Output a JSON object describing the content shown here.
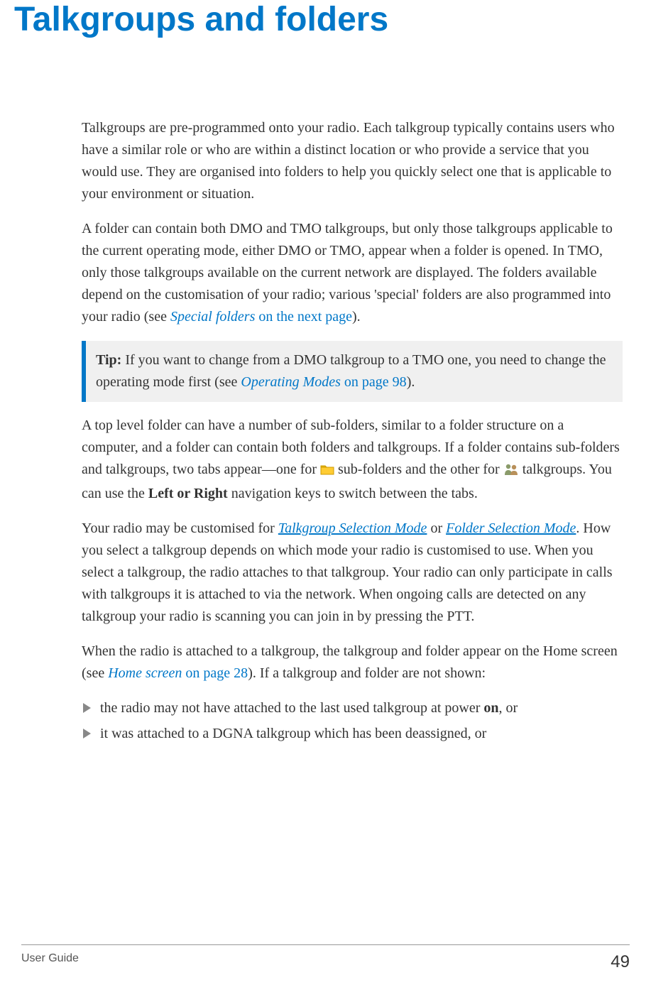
{
  "title": "Talkgroups and folders",
  "p1": "Talkgroups are pre-programmed onto your radio. Each talkgroup typically contains users who have a similar role or who are within a distinct location or who provide a service that you would use. They are organised into folders to help you quickly select one that is applicable to your environment or situation.",
  "p2_a": "A folder can contain both DMO and TMO talkgroups, but only those talkgroups applicable to the current operating mode, either DMO or TMO, appear when a folder is opened. In TMO, only those talkgroups available on the current network are displayed. The folders available depend on the customisation of your radio; various 'special' folders are also programmed into your radio (see ",
  "p2_link1": "Special folders",
  "p2_link2": " on the next page",
  "p2_b": ").",
  "tip_label": "Tip:",
  "tip_a": "  If you want to change from a DMO talkgroup to a TMO one, you need to change the operating mode first (see ",
  "tip_link1": "Operating Modes",
  "tip_link2": " on page 98",
  "tip_b": ").",
  "p3_a": "A top level folder can have a number of sub-folders, similar to a folder structure on a computer, and a folder can contain both folders and talkgroups. If a folder contains sub-folders and talkgroups, two tabs appear—one for ",
  "p3_b": " sub-folders and the other for ",
  "p3_c": " talkgroups. You can use the ",
  "p3_bold": "Left or Right",
  "p3_d": " navigation keys to switch between the tabs.",
  "p4_a": "Your radio may be customised for ",
  "p4_link1": "Talkgroup Selection Mode",
  "p4_b": " or ",
  "p4_link2": "Folder Selection Mode",
  "p4_c": ". How you select a talkgroup depends on which mode your radio is customised to use. When you select a talkgroup, the radio attaches to that talkgroup. Your radio can only participate in calls with talkgroups it is attached to via the network. When ongoing calls are detected on any talkgroup your radio is scanning you can join in by pressing the PTT.",
  "p5_a": "When the radio is attached to a talkgroup, the talkgroup and folder appear on the Home screen (see ",
  "p5_link1": "Home screen",
  "p5_link2": " on page 28",
  "p5_b": "). If a talkgroup and folder are not shown:",
  "bullets": {
    "b1_a": "the radio may not have attached to the last used talkgroup at power ",
    "b1_bold": "on",
    "b1_b": ", or",
    "b2": "it was attached to a DGNA talkgroup which has been deassigned, or"
  },
  "footer_left": "User Guide",
  "footer_right": "49"
}
